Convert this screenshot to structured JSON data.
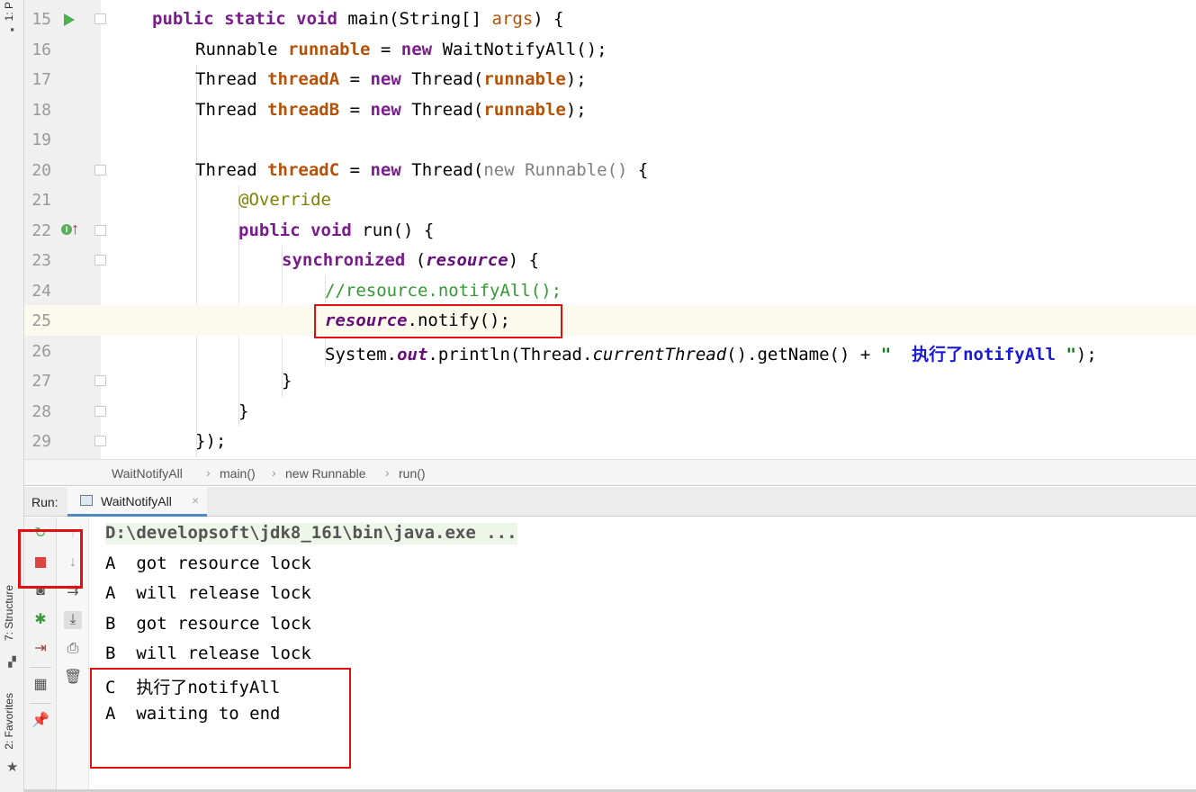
{
  "left_strip": {
    "project_tab": "1: P",
    "structure_tab": "7: Structure",
    "favorites_tab": "2: Favorites"
  },
  "editor": {
    "lines": [
      {
        "n": "15"
      },
      {
        "n": "16"
      },
      {
        "n": "17"
      },
      {
        "n": "18"
      },
      {
        "n": "19"
      },
      {
        "n": "20"
      },
      {
        "n": "21"
      },
      {
        "n": "22"
      },
      {
        "n": "23"
      },
      {
        "n": "24"
      },
      {
        "n": "25"
      },
      {
        "n": "26"
      },
      {
        "n": "27"
      },
      {
        "n": "28"
      },
      {
        "n": "29"
      }
    ],
    "tokens": {
      "l15_a": "public static void ",
      "l15_b": "main(String[] ",
      "l15_c": "args",
      "l15_d": ") {",
      "l16_a": "Runnable ",
      "l16_b": "runnable",
      "l16_c": " = ",
      "l16_d": "new ",
      "l16_e": "WaitNotifyAll();",
      "l17_a": "Thread ",
      "l17_b": "threadA",
      "l17_c": " = ",
      "l17_d": "new ",
      "l17_e": "Thread(",
      "l17_f": "runnable",
      "l17_g": ");",
      "l18_a": "Thread ",
      "l18_b": "threadB",
      "l18_c": " = ",
      "l18_d": "new ",
      "l18_e": "Thread(",
      "l18_f": "runnable",
      "l18_g": ");",
      "l20_a": "Thread ",
      "l20_b": "threadC",
      "l20_c": " = ",
      "l20_d": "new ",
      "l20_e": "Thread(",
      "l20_f": "new Runnable()",
      "l20_g": " {",
      "l21_a": "@Override",
      "l22_a": "public void ",
      "l22_b": "run() {",
      "l23_a": "synchronized ",
      "l23_b": "(",
      "l23_c": "resource",
      "l23_d": ") {",
      "l24_a": "//resource.notifyAll();",
      "l25_a": "resource",
      "l25_b": ".notify();",
      "l26_a": "System.",
      "l26_b": "out",
      "l26_c": ".println(Thread.",
      "l26_d": "currentThread",
      "l26_e": "().getName() + ",
      "l26_f": "\"  ",
      "l26_g": "执行了notifyAll ",
      "l26_h": "\"",
      "l26_i": ");",
      "l27_a": "}",
      "l28_a": "}",
      "l29_a": "});"
    }
  },
  "breadcrumb": [
    "WaitNotifyAll",
    "main()",
    "new Runnable",
    "run()"
  ],
  "run_panel": {
    "label": "Run:",
    "tab": "WaitNotifyAll",
    "close": "×"
  },
  "console": {
    "command": "D:\\developsoft\\jdk8_161\\bin\\java.exe ...",
    "output": [
      "A  got resource lock",
      "A  will release lock",
      "B  got resource lock",
      "B  will release lock",
      "C  执行了notifyAll",
      "A  waiting to end"
    ]
  },
  "colors": {
    "highlight_box": "#e01010",
    "keyword": "#7a1c8c",
    "local_var": "#b55208",
    "comment": "#339933",
    "current_line": "#fcfaed"
  }
}
